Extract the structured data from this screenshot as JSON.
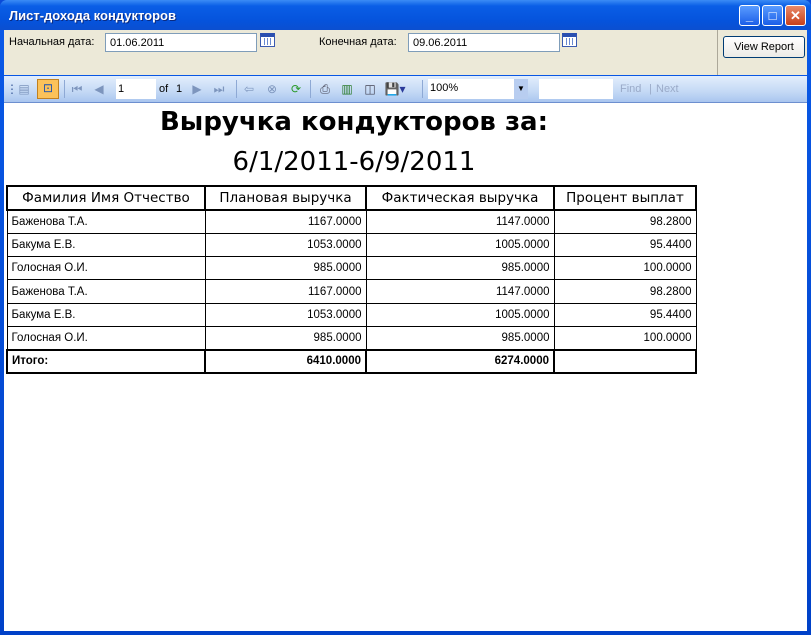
{
  "window": {
    "title": "Лист-дохода кондукторов"
  },
  "params": {
    "start_label": "Начальная дата:",
    "start_value": "01.06.2011",
    "end_label": "Конечная дата:",
    "end_value": "09.06.2011",
    "view_report": "View Report"
  },
  "toolbar": {
    "page": "1",
    "of_label": "of",
    "total_pages": "1",
    "zoom": "100%",
    "find": "Find",
    "next": "Next",
    "find_value": ""
  },
  "report": {
    "title": "Выручка кондукторов за:",
    "date_range": "6/1/2011-6/9/2011",
    "columns": [
      "Фамилия Имя Отчество",
      "Плановая выручка",
      "Фактическая выручка",
      "Процент выплат"
    ],
    "rows": [
      [
        "Баженова Т.А.",
        "1167.0000",
        "1147.0000",
        "98.2800"
      ],
      [
        "Бакума Е.В.",
        "1053.0000",
        "1005.0000",
        "95.4400"
      ],
      [
        "Голосная О.И.",
        "985.0000",
        "985.0000",
        "100.0000"
      ],
      [
        "Баженова Т.А.",
        "1167.0000",
        "1147.0000",
        "98.2800"
      ],
      [
        "Бакума Е.В.",
        "1053.0000",
        "1005.0000",
        "95.4400"
      ],
      [
        "Голосная О.И.",
        "985.0000",
        "985.0000",
        "100.0000"
      ]
    ],
    "total": {
      "label": "Итого:",
      "planned": "6410.0000",
      "actual": "6274.0000"
    }
  }
}
